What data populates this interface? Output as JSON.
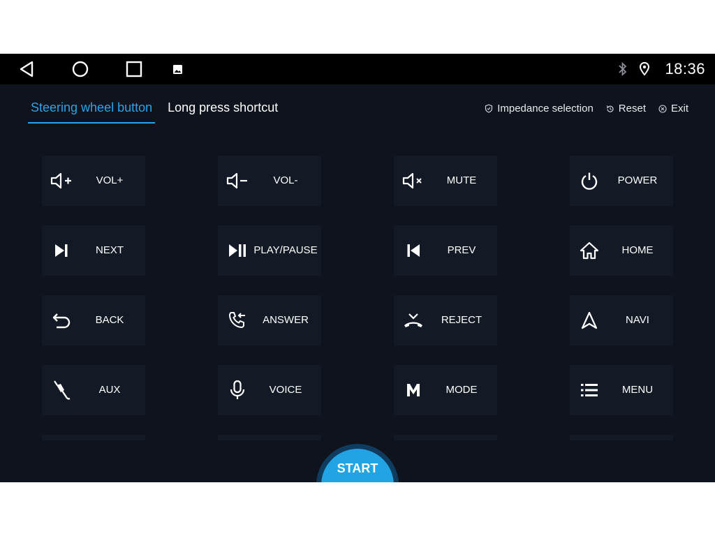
{
  "statusbar": {
    "time": "18:36",
    "icons": [
      "back-icon",
      "home-icon",
      "recents-icon",
      "gallery-icon",
      "bluetooth-icon",
      "location-icon"
    ]
  },
  "tabs": [
    {
      "label": "Steering wheel button",
      "active": true
    },
    {
      "label": "Long press shortcut",
      "active": false
    }
  ],
  "actions": {
    "impedance": "Impedance selection",
    "reset": "Reset",
    "exit": "Exit"
  },
  "keys": [
    {
      "label": "VOL+",
      "icon": "volume-up-icon"
    },
    {
      "label": "VOL-",
      "icon": "volume-down-icon"
    },
    {
      "label": "MUTE",
      "icon": "mute-icon"
    },
    {
      "label": "POWER",
      "icon": "power-icon"
    },
    {
      "label": "NEXT",
      "icon": "next-track-icon"
    },
    {
      "label": "PLAY/PAUSE",
      "icon": "play-pause-icon"
    },
    {
      "label": "PREV",
      "icon": "previous-track-icon"
    },
    {
      "label": "HOME",
      "icon": "home-icon"
    },
    {
      "label": "BACK",
      "icon": "back-arrow-icon"
    },
    {
      "label": "ANSWER",
      "icon": "answer-call-icon"
    },
    {
      "label": "REJECT",
      "icon": "reject-call-icon"
    },
    {
      "label": "NAVI",
      "icon": "navigation-icon"
    },
    {
      "label": "AUX",
      "icon": "aux-cable-icon"
    },
    {
      "label": "VOICE",
      "icon": "microphone-icon"
    },
    {
      "label": "MODE",
      "icon": "mode-icon"
    },
    {
      "label": "MENU",
      "icon": "menu-list-icon"
    }
  ],
  "start_label": "START",
  "colors": {
    "background": "#0e131d",
    "key_background": "#131a26",
    "accent": "#2fa3e6",
    "start_button": "#22a3e3"
  }
}
